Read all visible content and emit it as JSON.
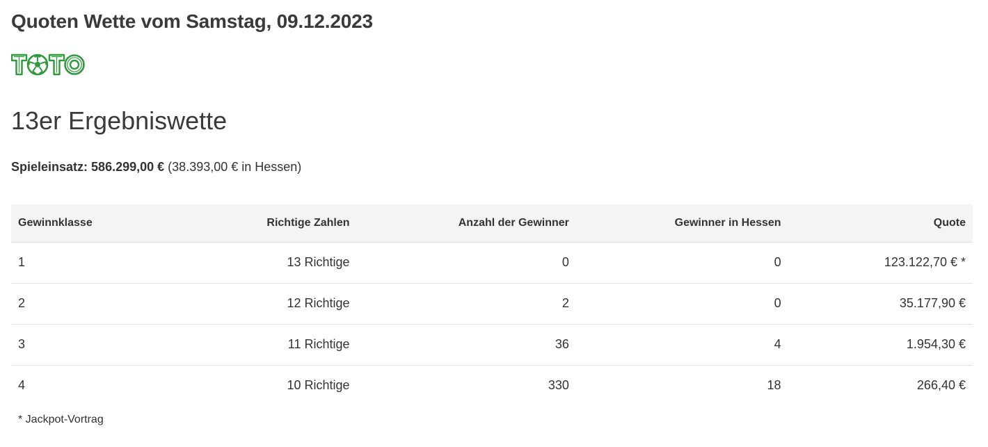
{
  "page": {
    "title": "Quoten Wette vom Samstag, 09.12.2023"
  },
  "logo": {
    "letters": [
      "T",
      "O",
      "T",
      "O"
    ],
    "text": "TOTO",
    "color": "#2e9a3e"
  },
  "game": {
    "title": "13er Ergebniswette"
  },
  "stake": {
    "label": "Spieleinsatz:",
    "amount": "586.299,00 €",
    "regional": "(38.393,00 € in Hessen)"
  },
  "table": {
    "headers": [
      "Gewinnklasse",
      "Richtige Zahlen",
      "Anzahl der Gewinner",
      "Gewinner in Hessen",
      "Quote"
    ],
    "rows": [
      [
        "1",
        "13 Richtige",
        "0",
        "0",
        "123.122,70 € *"
      ],
      [
        "2",
        "12 Richtige",
        "2",
        "0",
        "35.177,90 €"
      ],
      [
        "3",
        "11 Richtige",
        "36",
        "4",
        "1.954,30 €"
      ],
      [
        "4",
        "10 Richtige",
        "330",
        "18",
        "266,40 €"
      ]
    ]
  },
  "footnote": "* Jackpot-Vortrag",
  "colors": {
    "header_bg": "#f4f4f4",
    "text": "#333333",
    "brand_green": "#2e9a3e"
  }
}
